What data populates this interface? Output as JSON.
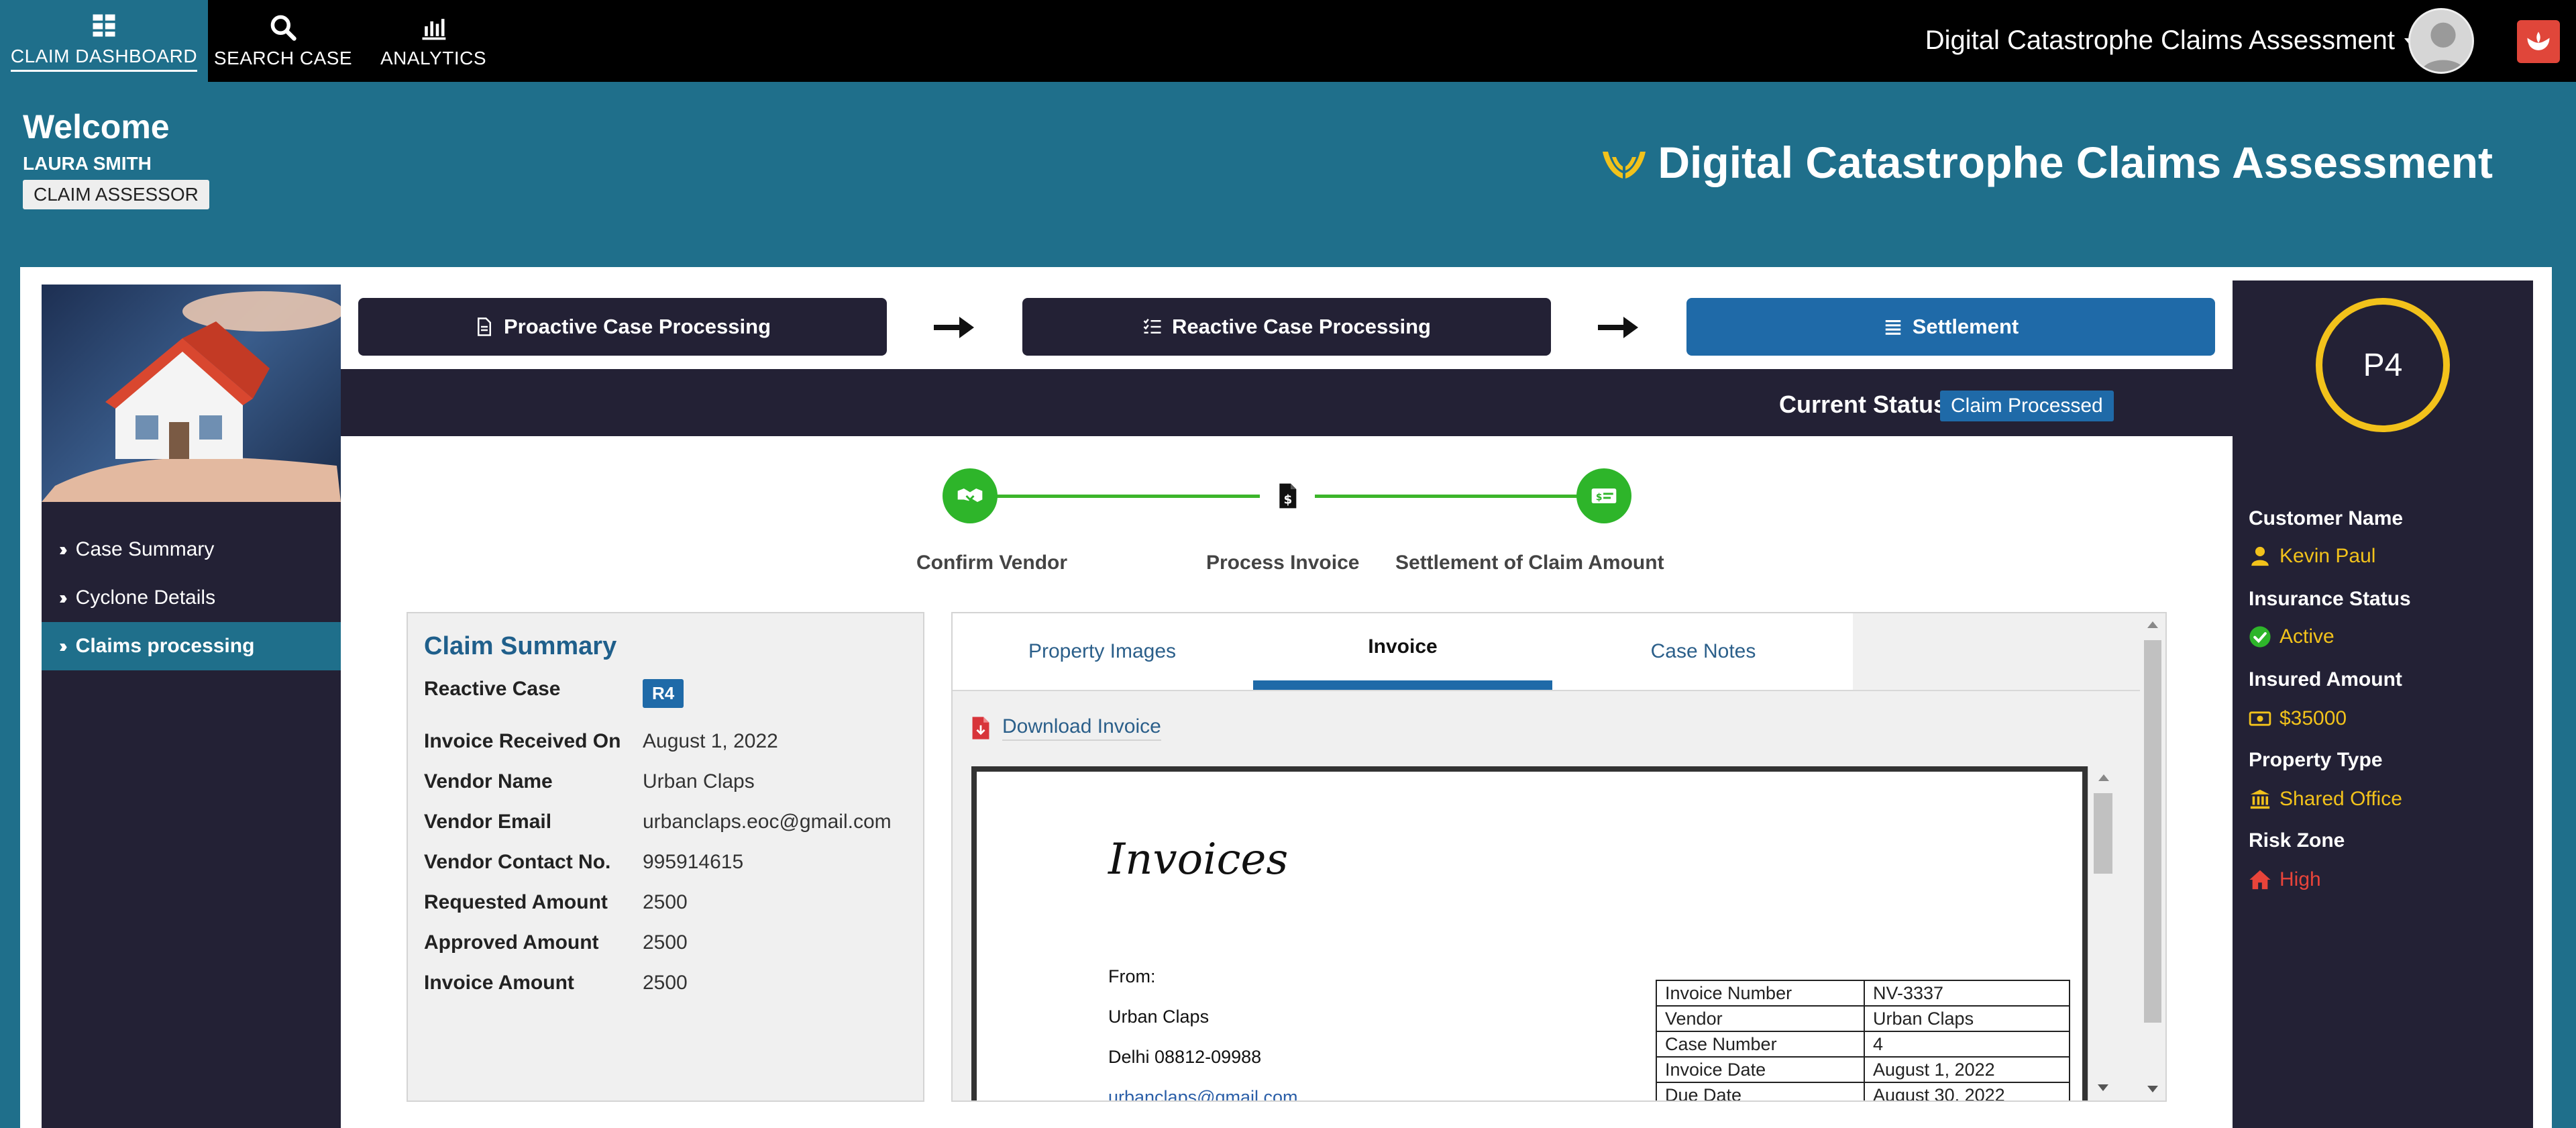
{
  "nav": {
    "items": [
      {
        "label": "CLAIM DASHBOARD",
        "icon": "dashboard-icon"
      },
      {
        "label": "SEARCH CASE",
        "icon": "search-icon"
      },
      {
        "label": "ANALYTICS",
        "icon": "bar-chart-icon"
      }
    ],
    "brand_dropdown": "Digital Catastrophe Claims Assessment"
  },
  "header": {
    "welcome": "Welcome",
    "user_name": "LAURA SMITH",
    "role": "CLAIM ASSESSOR",
    "app_title": "Digital Catastrophe Claims Assessment"
  },
  "sidebar": {
    "items": [
      {
        "label": "Case Summary"
      },
      {
        "label": "Cyclone Details"
      },
      {
        "label": "Claims processing"
      }
    ]
  },
  "steps": [
    {
      "label": "Proactive Case Processing"
    },
    {
      "label": "Reactive Case Processing"
    },
    {
      "label": "Settlement"
    }
  ],
  "status": {
    "label": "Current Status",
    "value": "Claim Processed"
  },
  "tracker": [
    {
      "label": "Confirm Vendor"
    },
    {
      "label": "Process Invoice"
    },
    {
      "label": "Settlement of Claim Amount"
    }
  ],
  "claim_summary": {
    "title": "Claim Summary",
    "reactive_case_label": "Reactive Case",
    "reactive_case_badge": "R4",
    "rows": [
      {
        "key": "Invoice Received On",
        "value": "August 1, 2022"
      },
      {
        "key": "Vendor Name",
        "value": "Urban Claps"
      },
      {
        "key": "Vendor Email",
        "value": "urbanclaps.eoc@gmail.com"
      },
      {
        "key": "Vendor Contact No.",
        "value": "995914615"
      },
      {
        "key": "Requested Amount",
        "value": "2500"
      },
      {
        "key": "Approved Amount",
        "value": "2500"
      },
      {
        "key": "Invoice Amount",
        "value": "2500"
      }
    ]
  },
  "tabs": [
    {
      "label": "Property Images"
    },
    {
      "label": "Invoice"
    },
    {
      "label": "Case Notes"
    }
  ],
  "download_label": "Download Invoice",
  "invoice": {
    "title": "Invoices",
    "from_label": "From:",
    "from_name": "Urban Claps",
    "from_phone": "Delhi 08812-09988",
    "from_email": "urbanclaps@gmail.com",
    "table": [
      {
        "k": "Invoice Number",
        "v": "NV-3337"
      },
      {
        "k": "Vendor",
        "v": "Urban Claps"
      },
      {
        "k": "Case Number",
        "v": "4"
      },
      {
        "k": "Invoice Date",
        "v": "August 1, 2022"
      },
      {
        "k": "Due Date",
        "v": "August 30, 2022"
      }
    ]
  },
  "customer": {
    "priority": "P4",
    "name_label": "Customer Name",
    "name": "Kevin Paul",
    "insurance_label": "Insurance Status",
    "insurance": "Active",
    "amount_label": "Insured Amount",
    "amount": "$35000",
    "property_label": "Property Type",
    "property": "Shared Office",
    "risk_label": "Risk Zone",
    "risk": "High"
  },
  "colors": {
    "header_teal": "#1f6f8b",
    "nav_dark": "#232135",
    "accent_blue": "#1f6aa8",
    "accent_yellow": "#f2c21b",
    "success_green": "#2eb52a",
    "risk_red": "#e8443a"
  }
}
